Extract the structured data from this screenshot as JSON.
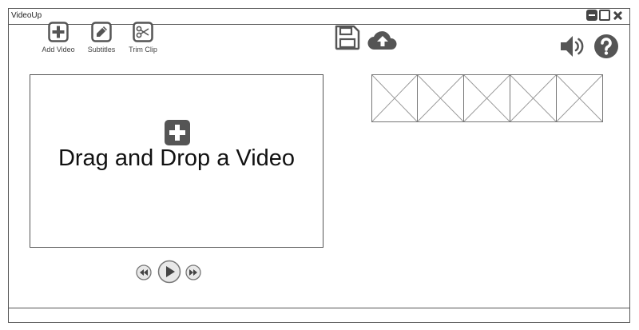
{
  "window": {
    "title": "VideoUp"
  },
  "toolbar": {
    "add_video": "Add Video",
    "subtitles": "Subtitles",
    "trim_clip": "Trim Clip"
  },
  "dropzone": {
    "text": "Drag and Drop a Video"
  },
  "thumbnails": {
    "count": 5
  },
  "icons": {
    "accent": "#555555",
    "names": [
      "add-video-icon",
      "subtitles-icon",
      "trim-clip-icon",
      "save-icon",
      "upload-cloud-icon",
      "volume-icon",
      "help-icon",
      "rewind-icon",
      "play-icon",
      "fast-forward-icon"
    ]
  }
}
